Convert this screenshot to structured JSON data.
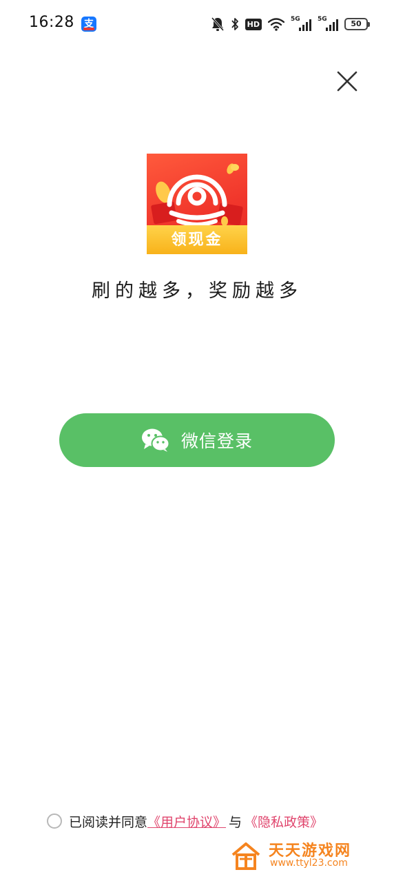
{
  "status_bar": {
    "time": "16:28",
    "app_notification_glyph": "支",
    "hd_label": "HD",
    "network_label": "5G",
    "battery_level": "50",
    "icons": [
      "mute-bell-icon",
      "bluetooth-icon",
      "hd-volte-icon",
      "wifi-icon",
      "signal-5g-icon",
      "signal-5g-icon",
      "battery-icon"
    ]
  },
  "header": {
    "close_icon": "close-icon"
  },
  "app": {
    "logo_text": "领现金",
    "slogan": "刷的越多，奖励越多",
    "brand_colors": {
      "red": "#f0352b",
      "gold": "#f8b21a"
    }
  },
  "login": {
    "wechat_label": "微信登录",
    "wechat_icon": "wechat-icon",
    "button_color": "#59c066"
  },
  "agreement": {
    "checked": false,
    "prefix": "已阅读并同意",
    "user_agreement": "《用户协议》",
    "connector": "与",
    "privacy_policy": "《隐私政策》",
    "link_color": "#e0456d"
  },
  "watermark": {
    "title": "天天游戏网",
    "url": "www.ttyl23.com",
    "color": "#f5841f"
  }
}
